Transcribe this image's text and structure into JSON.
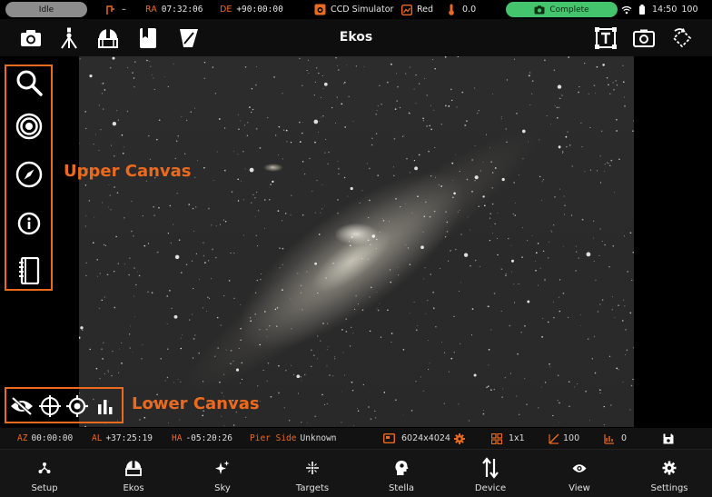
{
  "status": {
    "idle_label": "Idle",
    "mount_dash": "–",
    "ra_label": "RA",
    "ra_value": "07:32:06",
    "de_label": "DE",
    "de_value": "+90:00:00",
    "camera_label": "CCD Simulator",
    "filter_label": "Red",
    "temperature": "0.0",
    "capture_status": "Complete",
    "battery": "100",
    "time": "14:50",
    "accent_color": "#ec6a1e",
    "complete_color": "#44c46c"
  },
  "toolbar": {
    "title": "Ekos",
    "icons": [
      "camera-icon",
      "telescope-icon",
      "observatory-dome-icon",
      "bookmark-icon",
      "filter-icon",
      "text-frame-icon",
      "screenshot-icon",
      "rotate-icon"
    ]
  },
  "upper_canvas": {
    "label": "Upper Canvas",
    "icons": [
      "search-icon",
      "target-icon",
      "compass-icon",
      "info-icon",
      "notebook-icon"
    ]
  },
  "lower_canvas": {
    "label": "Lower Canvas",
    "icons": [
      "eye-off-icon",
      "crosshair-icon",
      "gps-target-icon",
      "bar-chart-icon"
    ]
  },
  "info_bar": {
    "az_label": "AZ",
    "az_value": "00:00:00",
    "al_label": "AL",
    "al_value": "+37:25:19",
    "ha_label": "HA",
    "ha_value": "-05:20:26",
    "pier_label": "Pier Side",
    "pier_value": "Unknown",
    "resolution": "6024x4024",
    "binning": "1x1",
    "gain": "100",
    "offset": "0"
  },
  "nav": [
    {
      "label": "Setup",
      "icon": "setup-icon"
    },
    {
      "label": "Ekos",
      "icon": "ekos-dome-icon"
    },
    {
      "label": "Sky",
      "icon": "sparkle-icon"
    },
    {
      "label": "Targets",
      "icon": "targets-icon"
    },
    {
      "label": "Stella",
      "icon": "stella-head-icon"
    },
    {
      "label": "Device",
      "icon": "device-arrows-icon"
    },
    {
      "label": "View",
      "icon": "eye-icon"
    },
    {
      "label": "Settings",
      "icon": "gear-icon"
    }
  ]
}
